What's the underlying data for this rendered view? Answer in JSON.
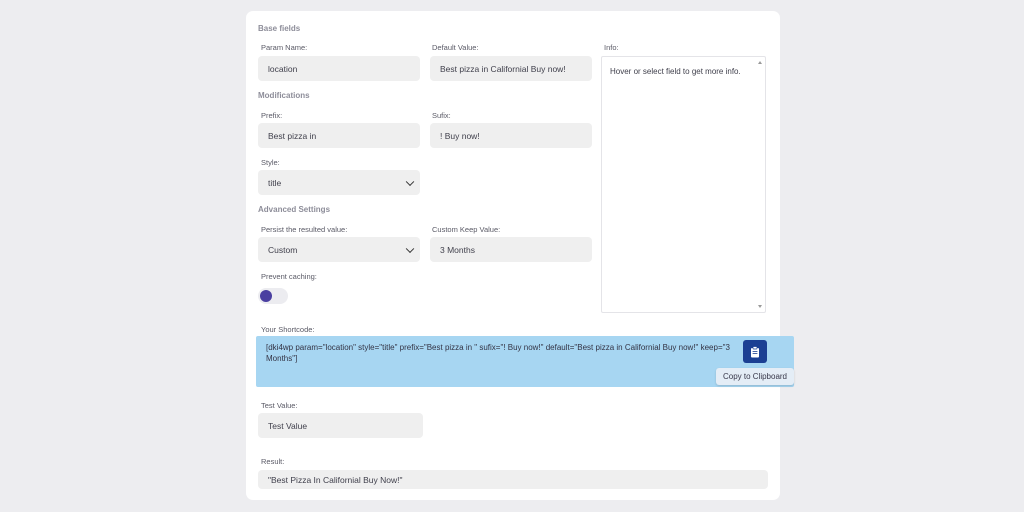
{
  "base_fields": {
    "section_title": "Base fields",
    "param_name_label": "Param Name:",
    "param_name_value": "location",
    "default_value_label": "Default Value:",
    "default_value_value": "Best pizza in Californial Buy now!",
    "info_label": "Info:",
    "info_text": "Hover or select field to get more info."
  },
  "modifications": {
    "section_title": "Modifications",
    "prefix_label": "Prefix:",
    "prefix_value": "Best pizza in",
    "sufix_label": "Sufix:",
    "sufix_value": "! Buy now!",
    "style_label": "Style:",
    "style_value": "title"
  },
  "advanced": {
    "section_title": "Advanced Settings",
    "persist_label": "Persist the resulted value:",
    "persist_value": "Custom",
    "keep_label": "Custom Keep Value:",
    "keep_value": "3 Months",
    "caching_label": "Prevent caching:",
    "caching_enabled": true
  },
  "shortcode": {
    "label": "Your Shortcode:",
    "text": "[dki4wp param=\"location\" style=\"title\" prefix=\"Best pizza in \" sufix=\"! Buy now!\" default=\"Best pizza in Californial Buy now!\" keep=\"3 Months\"]",
    "copy_icon": "clipboard-icon",
    "tooltip": "Copy to Clipboard"
  },
  "test": {
    "label": "Test Value:",
    "placeholder": "Test Value",
    "result_label": "Result:",
    "result_value": "\"Best Pizza In Californial Buy Now!\""
  },
  "colors": {
    "toggle_on": "#4a3fa0",
    "shortcode_bg": "#a7d6f2",
    "copy_button": "#1b3f93"
  }
}
